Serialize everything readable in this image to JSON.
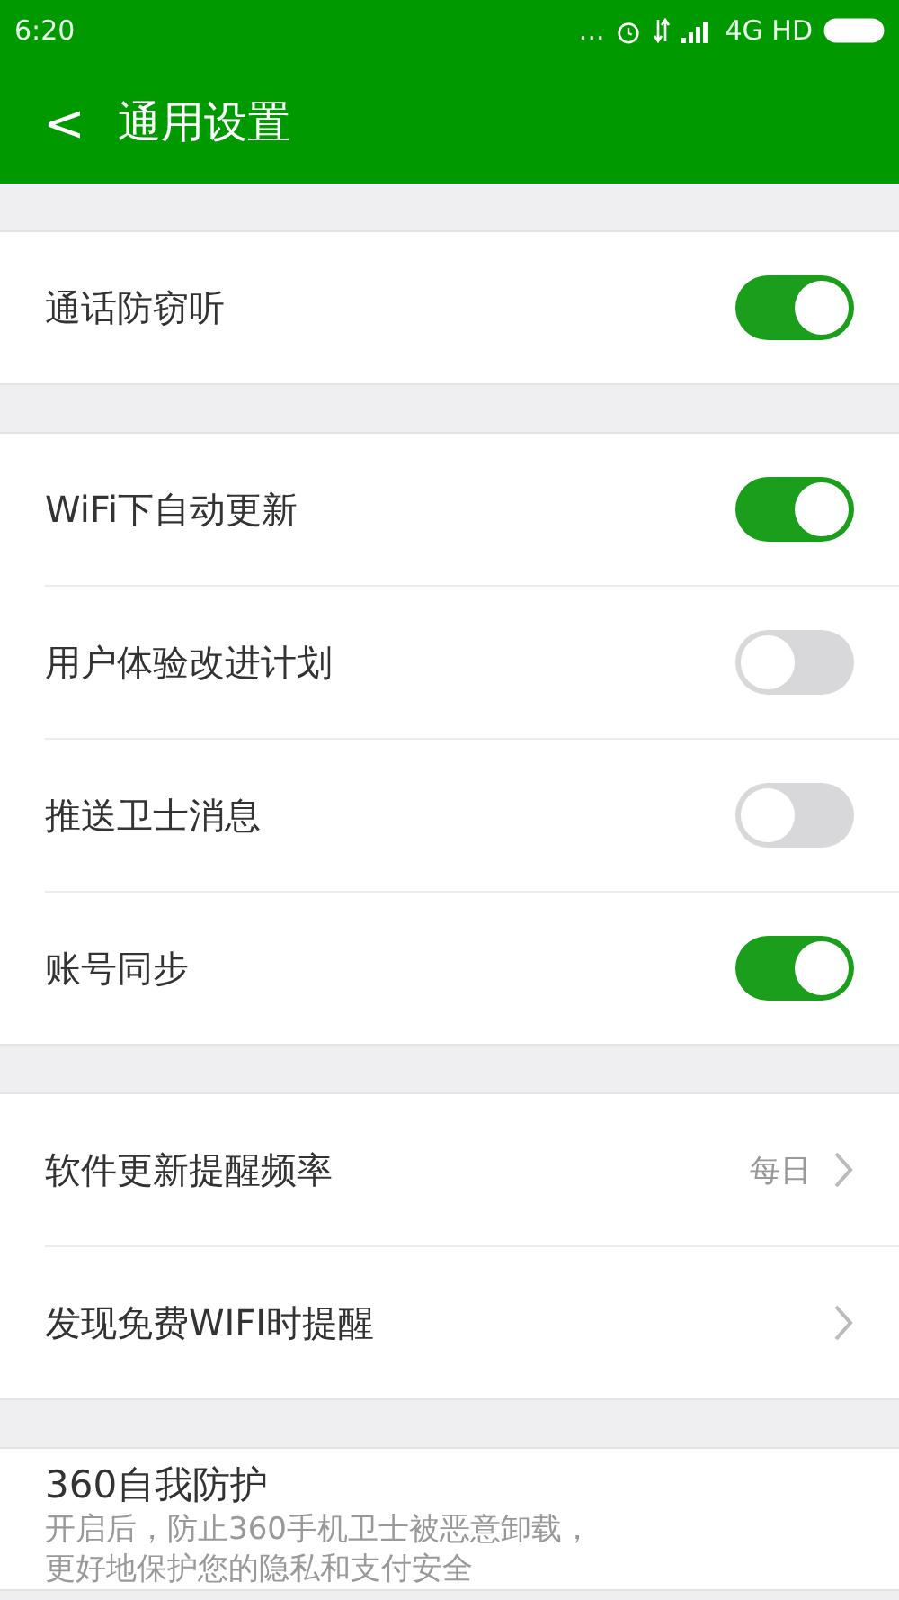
{
  "status_bar": {
    "time": "6:20",
    "indicators": "... ",
    "network": "4G HD"
  },
  "header": {
    "back": "<",
    "title": "通用设置"
  },
  "sections": [
    {
      "items": [
        {
          "kind": "toggle",
          "label": "通话防窃听",
          "on": true
        }
      ]
    },
    {
      "items": [
        {
          "kind": "toggle",
          "label": "WiFi下自动更新",
          "on": true
        },
        {
          "kind": "toggle",
          "label": "用户体验改进计划",
          "on": false
        },
        {
          "kind": "toggle",
          "label": "推送卫士消息",
          "on": false
        },
        {
          "kind": "toggle",
          "label": "账号同步",
          "on": true
        }
      ]
    },
    {
      "items": [
        {
          "kind": "link",
          "label": "软件更新提醒频率",
          "value": "每日"
        },
        {
          "kind": "link",
          "label": "发现免费WIFI时提醒"
        }
      ]
    },
    {
      "items": [
        {
          "kind": "info",
          "label": "360自我防护",
          "description": [
            "开启后，防止360手机卫士被恶意卸载，",
            "更好地保护您的隐私和支付安全"
          ]
        }
      ]
    }
  ]
}
